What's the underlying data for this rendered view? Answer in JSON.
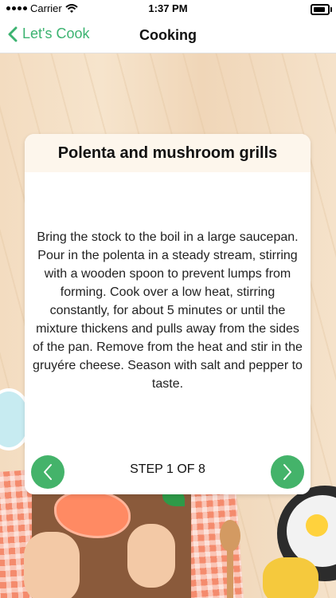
{
  "status_bar": {
    "carrier": "Carrier",
    "time": "1:37 PM"
  },
  "nav": {
    "back_label": "Let's Cook",
    "title": "Cooking"
  },
  "card": {
    "title": "Polenta and mushroom grills",
    "instructions": "Bring the stock to the boil in a large saucepan. Pour in the polenta in a steady stream, stirring with a wooden spoon to prevent lumps from forming. Cook over a low heat, stirring constantly, for about 5 minutes or until the mixture thickens and pulls away from the sides of the pan. Remove from the heat and stir in the gruyére cheese. Season with salt and pepper to taste.",
    "step_text": "STEP 1 OF 8"
  },
  "controls": {
    "prev_icon": "chevron-left-icon",
    "next_icon": "chevron-right-icon"
  },
  "colors": {
    "accent": "#3cb371",
    "button": "#44b36a",
    "card_header": "#fdf6ec"
  }
}
